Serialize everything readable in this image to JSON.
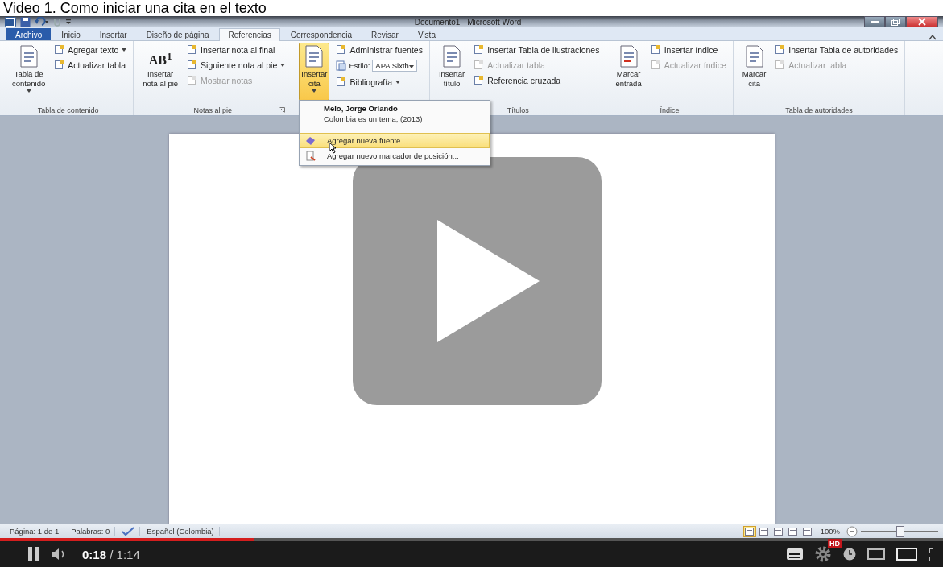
{
  "caption": "Video 1. Como iniciar una cita en el texto",
  "window": {
    "title": "Documento1 - Microsoft Word"
  },
  "tabs": [
    {
      "label": "Archivo",
      "kind": "file",
      "selected": false
    },
    {
      "label": "Inicio",
      "kind": "tab",
      "selected": false
    },
    {
      "label": "Insertar",
      "kind": "tab",
      "selected": false
    },
    {
      "label": "Diseño de página",
      "kind": "tab",
      "selected": false
    },
    {
      "label": "Referencias",
      "kind": "tab",
      "selected": true
    },
    {
      "label": "Correspondencia",
      "kind": "tab",
      "selected": false
    },
    {
      "label": "Revisar",
      "kind": "tab",
      "selected": false
    },
    {
      "label": "Vista",
      "kind": "tab",
      "selected": false
    }
  ],
  "ribbon": [
    {
      "label": "Tabla de contenido",
      "large": {
        "label": "Tabla de\ncontenido",
        "dropdown": true,
        "active": false
      },
      "items": [
        {
          "kind": "button",
          "label": "Agregar texto",
          "dropdown": true,
          "disabled": false
        },
        {
          "kind": "button",
          "label": "Actualizar tabla",
          "dropdown": false,
          "disabled": false
        }
      ]
    },
    {
      "label": "Notas al pie",
      "launcher": true,
      "large": {
        "label": "Insertar\nnota al pie",
        "glyph": "AB$^{1}$",
        "dropdown": false,
        "active": false
      },
      "items": [
        {
          "kind": "button",
          "label": "Insertar nota al final",
          "dropdown": false,
          "disabled": false
        },
        {
          "kind": "button",
          "label": "Siguiente nota al pie",
          "dropdown": true,
          "disabled": false
        },
        {
          "kind": "button",
          "label": "Mostrar notas",
          "dropdown": false,
          "disabled": true
        }
      ]
    },
    {
      "large": {
        "label": "Insertar\ncita",
        "dropdown": true,
        "active": true
      },
      "items": [
        {
          "kind": "button",
          "label": "Administrar fuentes",
          "dropdown": false,
          "disabled": false
        },
        {
          "kind": "combo",
          "label": "Estilo:",
          "value": "APA Sixth"
        },
        {
          "kind": "button",
          "label": "Bibliografía",
          "dropdown": true,
          "disabled": false
        }
      ]
    },
    {
      "label": "Títulos",
      "large": {
        "label": "Insertar\ntítulo",
        "dropdown": false,
        "active": false
      },
      "items": [
        {
          "kind": "button",
          "label": "Insertar Tabla de ilustraciones",
          "dropdown": false,
          "disabled": false
        },
        {
          "kind": "button",
          "label": "Actualizar tabla",
          "dropdown": false,
          "disabled": true
        },
        {
          "kind": "button",
          "label": "Referencia cruzada",
          "dropdown": false,
          "disabled": false
        }
      ]
    },
    {
      "label": "Índice",
      "large": {
        "label": "Marcar\nentrada",
        "dropdown": false,
        "active": false
      },
      "items": [
        {
          "kind": "button",
          "label": "Insertar índice",
          "dropdown": false,
          "disabled": false
        },
        {
          "kind": "button",
          "label": "Actualizar índice",
          "dropdown": false,
          "disabled": true
        }
      ]
    },
    {
      "label": "Tabla de autoridades",
      "large": {
        "label": "Marcar\ncita",
        "dropdown": false,
        "active": false
      },
      "items": [
        {
          "kind": "button",
          "label": "Insertar Tabla de autoridades",
          "dropdown": false,
          "disabled": false
        },
        {
          "kind": "button",
          "label": "Actualizar tabla",
          "dropdown": false,
          "disabled": true
        }
      ]
    }
  ],
  "menu": {
    "citation": {
      "author": "Melo, Jorge Orlando",
      "title": "Colombia es un tema, (2013)"
    },
    "items": [
      {
        "label": "Agregar nueva fuente...",
        "highlighted": true
      },
      {
        "label": "Agregar nuevo marcador de posición...",
        "highlighted": false
      }
    ]
  },
  "status_bar": {
    "items": [
      {
        "kind": "text",
        "label": "Página: 1 de 1"
      },
      {
        "kind": "text",
        "label": "Palabras: 0"
      },
      {
        "kind": "proofing"
      },
      {
        "kind": "text",
        "label": "Español (Colombia)"
      }
    ],
    "views": [
      {
        "selected": true
      },
      {
        "selected": false
      },
      {
        "selected": false
      },
      {
        "selected": false
      },
      {
        "selected": false
      }
    ],
    "zoom": "100%",
    "zoom_slider": {
      "level": 0.5
    }
  },
  "player": {
    "playing": true,
    "current": "0:18",
    "separator": "/",
    "duration": "1:14",
    "progress": {
      "level": 0.27
    },
    "quality_badge": "HD"
  }
}
